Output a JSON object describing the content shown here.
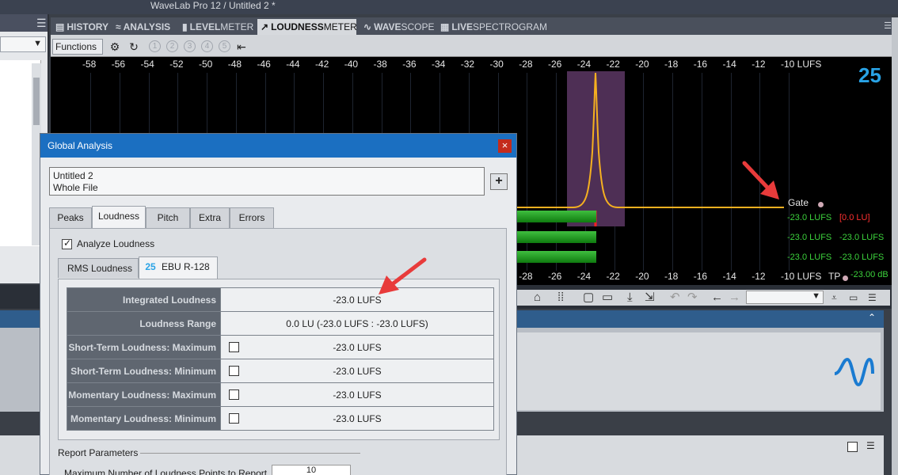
{
  "window": {
    "title": "WaveLab Pro 12 / Untitled 2 *"
  },
  "tabs": [
    {
      "label_bold": "HISTORY",
      "label_thin": ""
    },
    {
      "label_bold": "ANALYSIS",
      "label_thin": ""
    },
    {
      "label_bold": "LEVEL",
      "label_thin": "METER"
    },
    {
      "label_bold": "LOUDNESS",
      "label_thin": "METER"
    },
    {
      "label_bold": "WAVE",
      "label_thin": "SCOPE"
    },
    {
      "label_bold": "LIVE",
      "label_thin": "SPECTROGRAM"
    }
  ],
  "toolbar": {
    "functions_label": "Functions",
    "numbers": [
      "1",
      "2",
      "3",
      "4",
      "5"
    ]
  },
  "meter": {
    "ticks_top": [
      "-58",
      "-56",
      "-54",
      "-52",
      "-50",
      "-48",
      "-46",
      "-44",
      "-42",
      "-40",
      "-38",
      "-36",
      "-34",
      "-32",
      "-30",
      "-28",
      "-26",
      "-24",
      "-22",
      "-20",
      "-18",
      "-16",
      "-14",
      "-12",
      "-10 LUFS"
    ],
    "ticks_bottom": [
      "-28",
      "-26",
      "-24",
      "-22",
      "-20",
      "-18",
      "-16",
      "-14",
      "-12",
      "-10 LUFS"
    ],
    "gate_label": "Gate",
    "tp_label": "TP",
    "readouts": [
      {
        "left": "-23.0 LUFS",
        "right": "[0.0 LU]",
        "right_color": "#ff3030"
      },
      {
        "left": "-23.0 LUFS",
        "right": "-23.0 LUFS",
        "right_color": "#3cd23c"
      },
      {
        "left": "-23.0 LUFS",
        "right": "-23.0 LUFS",
        "right_color": "#3cd23c"
      }
    ],
    "tp_value": "-23.00 dB",
    "logo": "25"
  },
  "dialog": {
    "title": "Global Analysis",
    "file_line1": "Untitled 2",
    "file_line2": "Whole File",
    "tabs": [
      "Peaks",
      "Loudness",
      "Pitch",
      "Extra",
      "Errors"
    ],
    "active_tab": "Loudness",
    "analyze_label": "Analyze Loudness",
    "subtabs": [
      "RMS Loudness",
      "EBU R-128"
    ],
    "results": [
      {
        "label": "Integrated Loudness",
        "value": "-23.0 LUFS",
        "checkbox": false
      },
      {
        "label": "Loudness Range",
        "value": "0.0 LU (-23.0 LUFS : -23.0 LUFS)",
        "checkbox": false
      },
      {
        "label": "Short-Term Loudness: Maximum",
        "value": "-23.0 LUFS",
        "checkbox": true
      },
      {
        "label": "Short-Term Loudness: Minimum",
        "value": "-23.0 LUFS",
        "checkbox": true
      },
      {
        "label": "Momentary Loudness: Maximum",
        "value": "-23.0 LUFS",
        "checkbox": true
      },
      {
        "label": "Momentary Loudness: Minimum",
        "value": "-23.0 LUFS",
        "checkbox": true
      }
    ],
    "report_label": "Report Parameters",
    "max_points_label": "Maximum Number of Loudness Points to Report",
    "max_points_value": "10"
  },
  "colors": {
    "accent": "#1b6fc1",
    "meter_curve": "#f5b020",
    "meter_green": "#3cd23c",
    "arrow": "#e83b3b"
  }
}
